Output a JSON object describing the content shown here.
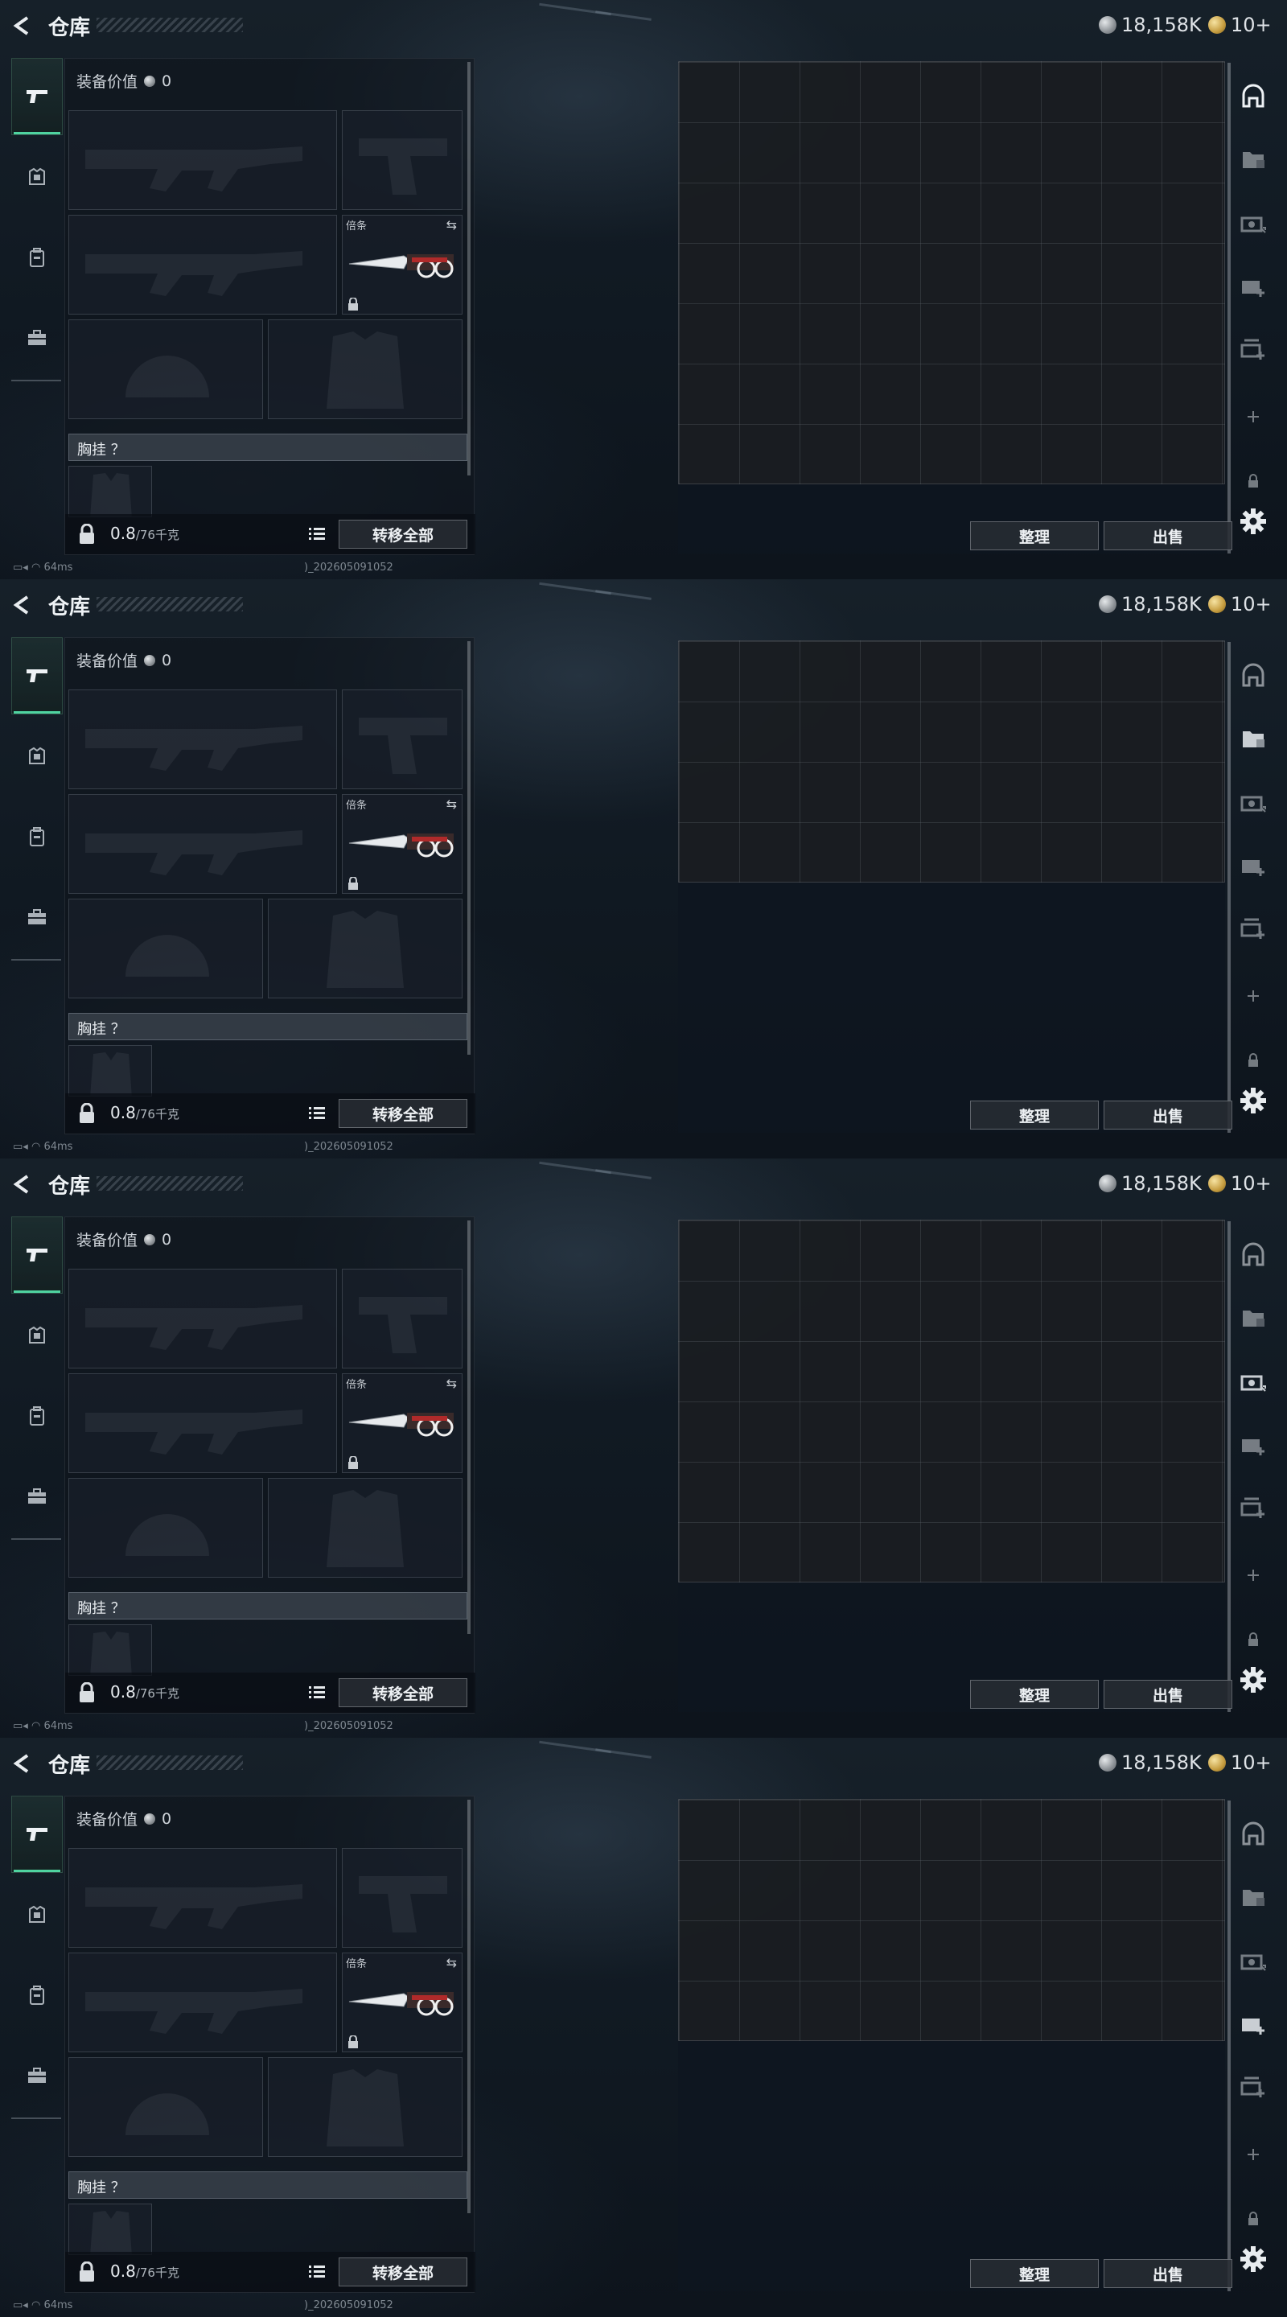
{
  "header": {
    "title": "仓库",
    "currency_silver": "18,158K",
    "currency_gold": "10+"
  },
  "equipment": {
    "value_label": "装备价值",
    "value": "0",
    "melee_label": "倍条",
    "chest_label": "胸挂 ？",
    "weight_value": "0.8",
    "weight_capacity": "/76千克",
    "transfer_all": "转移全部"
  },
  "storage": {
    "sort_button": "整理",
    "sell_button": "出售"
  },
  "status": {
    "ping": "64ms",
    "build": ")_202605091052"
  },
  "screens": [
    {
      "active_rail": "rail-home-icon",
      "grid_rows": 7
    },
    {
      "active_rail": "rail-folder-icon",
      "grid_rows": 4
    },
    {
      "active_rail": "rail-cash-icon",
      "grid_rows": 6
    },
    {
      "active_rail": "rail-case-icon",
      "grid_rows": 4
    }
  ],
  "colors": {
    "accent": "#4fd3a0",
    "panel": "#1a1d22",
    "gold": "#c59c3f"
  }
}
